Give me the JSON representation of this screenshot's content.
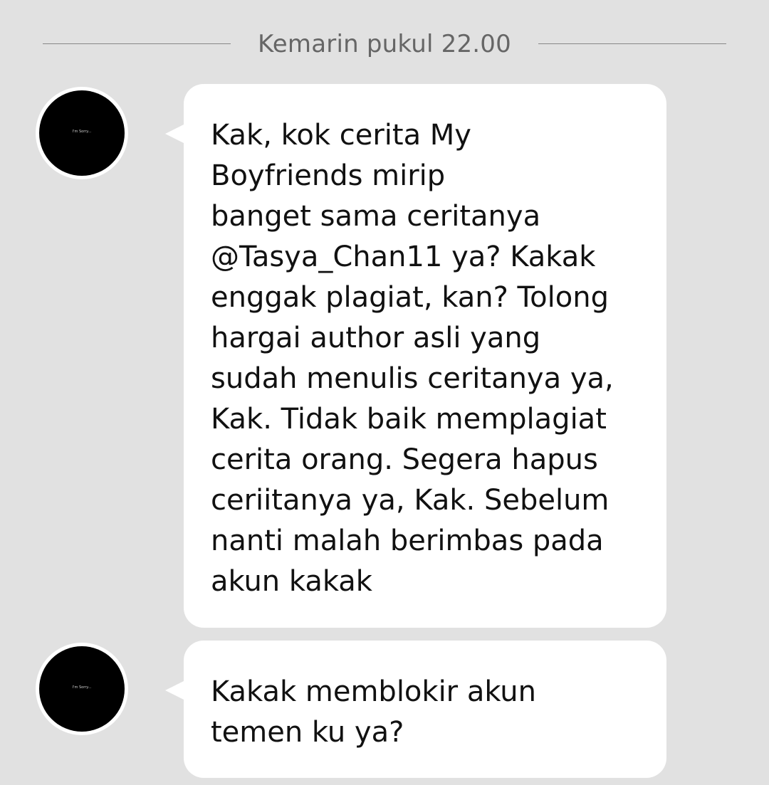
{
  "date_divider": {
    "label": "Kemarin pukul 22.00"
  },
  "messages": [
    {
      "sender_avatar_text": "I'm Sorry...",
      "text": "Kak, kok cerita My\nBoyfriends mirip\nbanget sama ceritanya\n@Tasya_Chan11 ya? Kakak\nenggak plagiat, kan? Tolong\nhargai author asli yang\nsudah menulis ceritanya ya,\nKak. Tidak baik memplagiat\ncerita orang. Segera hapus\nceriitanya ya, Kak. Sebelum\nnanti malah berimbas pada\nakun kakak"
    },
    {
      "sender_avatar_text": "I'm Sorry...",
      "text": "Kakak memblokir akun\ntemen ku ya?"
    }
  ],
  "colors": {
    "background": "#e1e1e1",
    "bubble": "#ffffff",
    "avatar": "#000000",
    "divider_text": "#666666"
  }
}
